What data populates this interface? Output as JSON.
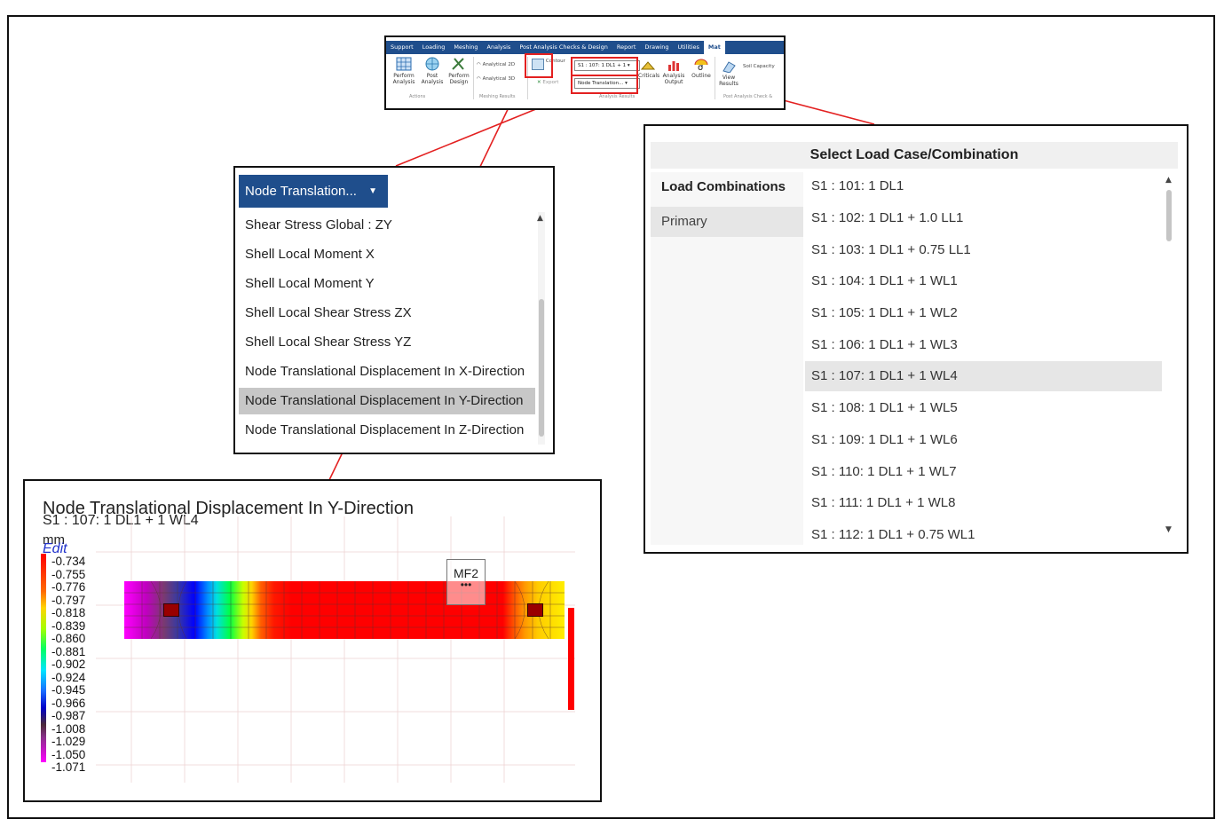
{
  "ribbon": {
    "tabs": [
      "Support",
      "Loading",
      "Meshing",
      "Analysis",
      "Post Analysis Checks & Design",
      "Report",
      "Drawing",
      "Utilities",
      "Mat"
    ],
    "active_tab": "Mat",
    "buttons": {
      "perform_analysis": "Perform Analysis",
      "post_analysis": "Post Analysis",
      "perform_design": "Perform Design",
      "analytical_2d": "Analytical 2D",
      "analytical_3d": "Analytical 3D",
      "contour": "Contour",
      "export": "Export",
      "criticals": "Criticals",
      "analysis_output": "Analysis Output",
      "outline": "Outline",
      "view_results": "View Results",
      "soil_capacity": "Soil Capacity"
    },
    "combo_load": "S1 : 107: 1 DL1 + 1",
    "combo_result": "Node Translation...",
    "groups": {
      "actions": "Actions",
      "meshing_results": "Meshing Results",
      "analysis_results": "Analysis Results",
      "post_analysis": "Post Analysis Check &"
    }
  },
  "dropdown": {
    "header": "Node Translation...",
    "items": [
      "Shear Stress Global : ZY",
      "Shell Local Moment X",
      "Shell Local Moment Y",
      "Shell Local Shear Stress ZX",
      "Shell Local Shear Stress YZ",
      "Node Translational Displacement In X-Direction",
      "Node Translational Displacement In Y-Direction",
      "Node Translational Displacement In Z-Direction"
    ],
    "selected_index": 6
  },
  "load_case": {
    "title": "Select Load Case/Combination",
    "categories": [
      "Load Combinations",
      "Primary"
    ],
    "items": [
      "S1 : 101: 1 DL1",
      "S1 : 102: 1 DL1 + 1.0 LL1",
      "S1 : 103: 1 DL1 + 0.75 LL1",
      "S1 : 104: 1 DL1 + 1 WL1",
      "S1 : 105: 1 DL1 + 1 WL2",
      "S1 : 106: 1 DL1 + 1 WL3",
      "S1 : 107: 1 DL1 + 1 WL4",
      "S1 : 108: 1 DL1 + 1 WL5",
      "S1 : 109: 1 DL1 + 1 WL6",
      "S1 : 110: 1 DL1 + 1 WL7",
      "S1 : 111: 1 DL1 + 1 WL8",
      "S1 : 112: 1 DL1 + 0.75 WL1"
    ],
    "selected_index": 6
  },
  "contour": {
    "title": "Node Translational Displacement In Y-Direction",
    "subtitle": "S1 : 107: 1 DL1 + 1 WL4",
    "unit": "mm",
    "edit": "Edit",
    "legend": [
      "-0.734",
      "-0.755",
      "-0.776",
      "-0.797",
      "-0.818",
      "-0.839",
      "-0.860",
      "-0.881",
      "-0.902",
      "-0.924",
      "-0.945",
      "-0.966",
      "-0.987",
      "-1.008",
      "-1.029",
      "-1.050",
      "-1.071"
    ],
    "marker": "MF2",
    "marker_dots": "•••"
  }
}
